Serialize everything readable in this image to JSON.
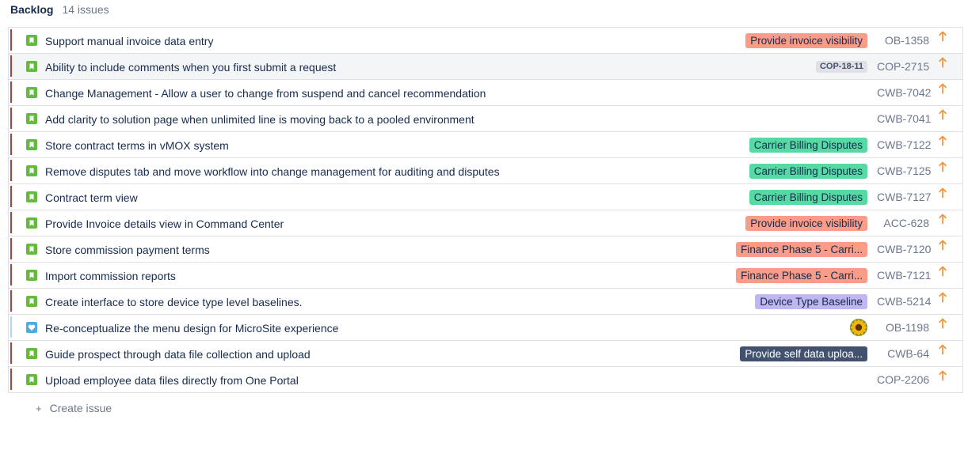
{
  "backlog": {
    "title": "Backlog",
    "count": "14 issues"
  },
  "colors": {
    "story": "#63ba3c",
    "improvement": "#4bade8",
    "priority_high": "#f79232"
  },
  "issues": [
    {
      "summary": "Support manual invoice data entry",
      "epic": "Provide invoice visibility",
      "epic_bg": "#f99c88",
      "epic_fg": "#172b4d",
      "key": "OB-1358",
      "type": "story-icon",
      "priority": "high-priority-icon"
    },
    {
      "summary": "Ability to include comments when you first submit a request",
      "sprint": "COP-18-11",
      "key": "COP-2715",
      "type": "story-icon",
      "priority": "high-priority-icon",
      "hover": true
    },
    {
      "summary": "Change Management - Allow a user to change from suspend and cancel recommendation",
      "key": "CWB-7042",
      "type": "story-icon",
      "priority": "high-priority-icon"
    },
    {
      "summary": "Add clarity to solution page when unlimited line is moving back to a pooled environment",
      "key": "CWB-7041",
      "type": "story-icon",
      "priority": "high-priority-icon"
    },
    {
      "summary": "Store contract terms in vMOX system",
      "epic": "Carrier Billing Disputes",
      "epic_bg": "#57d9a3",
      "epic_fg": "#172b4d",
      "key": "CWB-7122",
      "type": "story-icon",
      "priority": "high-priority-icon"
    },
    {
      "summary": "Remove disputes tab and move workflow into change management for auditing and disputes",
      "epic": "Carrier Billing Disputes",
      "epic_bg": "#57d9a3",
      "epic_fg": "#172b4d",
      "key": "CWB-7125",
      "type": "story-icon",
      "priority": "high-priority-icon"
    },
    {
      "summary": "Contract term view",
      "epic": "Carrier Billing Disputes",
      "epic_bg": "#57d9a3",
      "epic_fg": "#172b4d",
      "key": "CWB-7127",
      "type": "story-icon",
      "priority": "high-priority-icon"
    },
    {
      "summary": "Provide Invoice details view in Command Center",
      "epic": "Provide invoice visibility",
      "epic_bg": "#f99c88",
      "epic_fg": "#172b4d",
      "key": "ACC-628",
      "type": "story-icon",
      "priority": "high-priority-icon"
    },
    {
      "summary": "Store commission payment terms",
      "epic": "Finance Phase 5 - Carri...",
      "epic_bg": "#f99c88",
      "epic_fg": "#172b4d",
      "key": "CWB-7120",
      "type": "story-icon",
      "priority": "high-priority-icon"
    },
    {
      "summary": "Import commission reports",
      "epic": "Finance Phase 5 - Carri...",
      "epic_bg": "#f99c88",
      "epic_fg": "#172b4d",
      "key": "CWB-7121",
      "type": "story-icon",
      "priority": "high-priority-icon"
    },
    {
      "summary": "Create interface to store device type level baselines.",
      "epic": "Device Type Baseline",
      "epic_bg": "#c0b6f2",
      "epic_fg": "#172b4d",
      "key": "CWB-5214",
      "type": "story-icon",
      "priority": "high-priority-icon"
    },
    {
      "summary": "Re-conceptualize the menu design for MicroSite experience",
      "avatar": "sunflower-avatar",
      "key": "OB-1198",
      "type": "improvement-icon",
      "priority": "high-priority-icon",
      "light_bar": true
    },
    {
      "summary": "Guide prospect through data file collection and upload",
      "epic": "Provide self data uploa...",
      "epic_bg": "#42526e",
      "epic_fg": "#ffffff",
      "key": "CWB-64",
      "type": "story-icon",
      "priority": "high-priority-icon"
    },
    {
      "summary": "Upload employee data files directly from One Portal",
      "key": "COP-2206",
      "type": "story-icon",
      "priority": "high-priority-icon"
    }
  ],
  "create_issue": {
    "icon": "plus-icon",
    "label": "Create issue"
  }
}
